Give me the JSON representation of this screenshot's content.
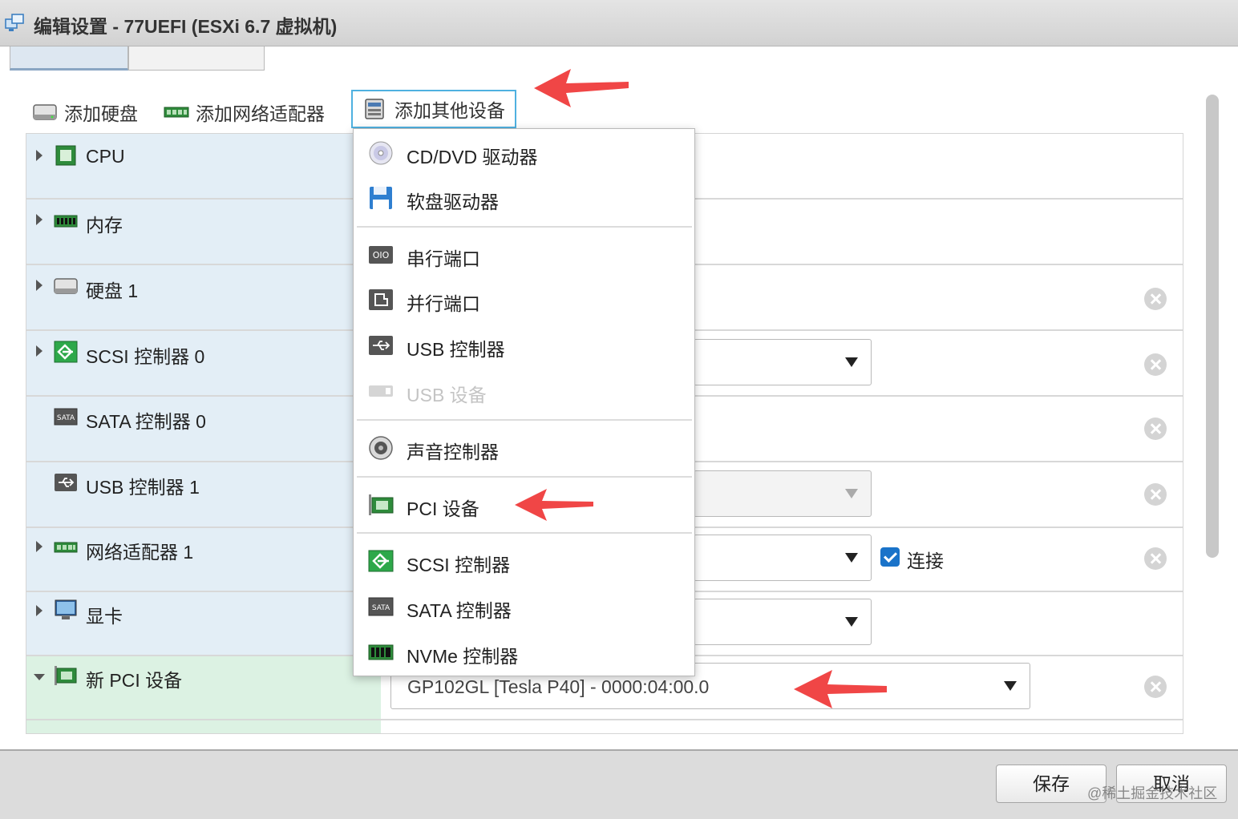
{
  "window": {
    "title": "编辑设置 - 77UEFI (ESXi 6.7 虚拟机)",
    "icon": "vm-settings-icon"
  },
  "tabs": [
    "",
    ""
  ],
  "toolbar": {
    "add_disk": "添加硬盘",
    "add_nic": "添加网络适配器",
    "add_other": "添加其他设备"
  },
  "rows": [
    {
      "label": "CPU",
      "icon": "cpu-icon",
      "expandable": true
    },
    {
      "label": "内存",
      "icon": "memory-icon",
      "expandable": true
    },
    {
      "label": "硬盘 1",
      "icon": "hard-disk-icon",
      "expandable": true
    },
    {
      "label": "SCSI 控制器 0",
      "icon": "scsi-icon",
      "expandable": true
    },
    {
      "label": "SATA 控制器 0",
      "icon": "sata-icon",
      "expandable": false
    },
    {
      "label": "USB 控制器 1",
      "icon": "usb-icon",
      "expandable": false
    },
    {
      "label": "网络适配器 1",
      "icon": "network-adapter-icon",
      "expandable": true
    },
    {
      "label": "显卡",
      "icon": "display-icon",
      "expandable": true
    },
    {
      "label": "新 PCI 设备",
      "icon": "pci-icon",
      "expandable": true,
      "expanded": true
    }
  ],
  "network": {
    "connect_label": "连接",
    "connected": true
  },
  "pci": {
    "selected_device": "GP102GL [Tesla P40] - 0000:04:00.0"
  },
  "menu": {
    "items": [
      {
        "label": "CD/DVD 驱动器",
        "icon": "cd-dvd-icon",
        "enabled": true
      },
      {
        "label": "软盘驱动器",
        "icon": "floppy-icon",
        "enabled": true
      },
      {
        "label": "串行端口",
        "icon": "serial-port-icon",
        "enabled": true
      },
      {
        "label": "并行端口",
        "icon": "parallel-port-icon",
        "enabled": true
      },
      {
        "label": "USB 控制器",
        "icon": "usb-controller-icon",
        "enabled": true
      },
      {
        "label": "USB 设备",
        "icon": "usb-device-icon",
        "enabled": false
      },
      {
        "label": "声音控制器",
        "icon": "sound-icon",
        "enabled": true
      },
      {
        "label": "PCI 设备",
        "icon": "pci-device-icon",
        "enabled": true
      },
      {
        "label": "SCSI 控制器",
        "icon": "scsi-controller-icon",
        "enabled": true
      },
      {
        "label": "SATA 控制器",
        "icon": "sata-controller-icon",
        "enabled": true
      },
      {
        "label": "NVMe 控制器",
        "icon": "nvme-controller-icon",
        "enabled": true
      }
    ]
  },
  "footer": {
    "save": "保存",
    "cancel": "取消",
    "watermark": "@稀土掘金技术社区"
  },
  "colors": {
    "left_column": "#e3eef6",
    "new_row": "#dcf2e3",
    "highlight_border": "#4fb1e0",
    "annotation_arrow": "#f04646",
    "checkbox": "#1a73c9"
  }
}
